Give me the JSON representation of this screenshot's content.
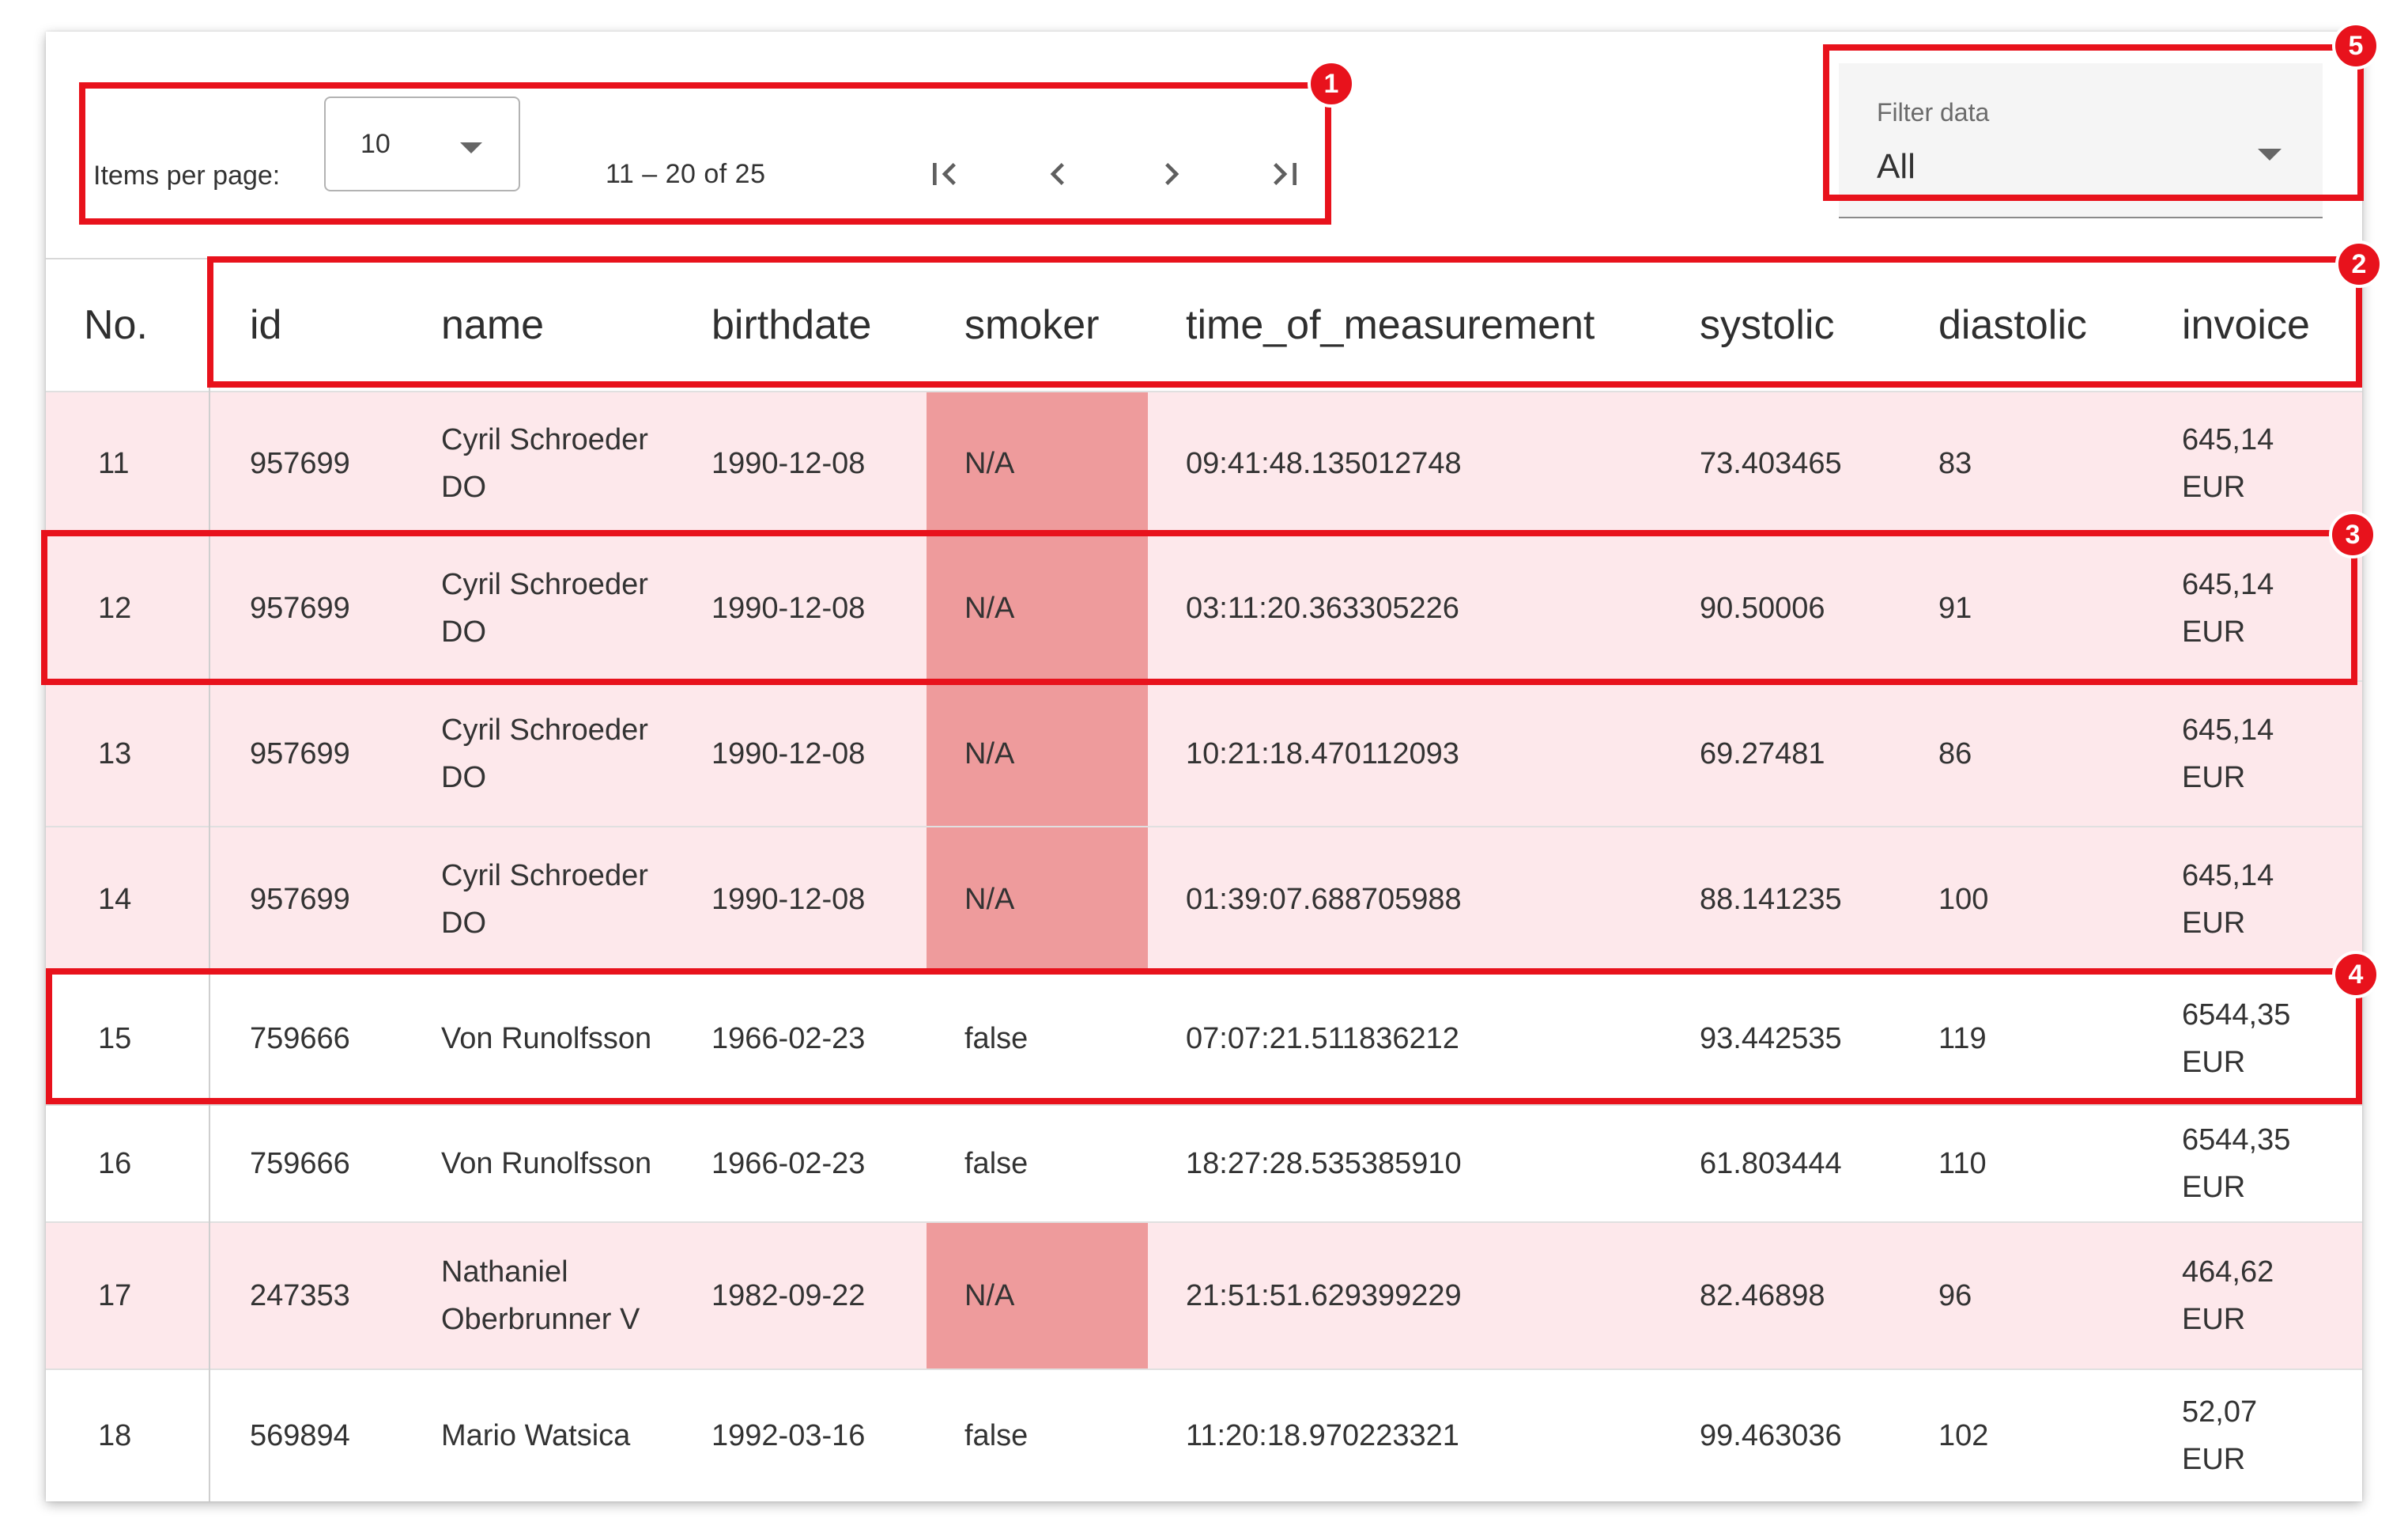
{
  "paginator": {
    "items_per_page_label": "Items per page:",
    "items_per_page_value": "10",
    "range_label": "11 – 20 of 25",
    "buttons": [
      "first-page-icon",
      "previous-page-icon",
      "next-page-icon",
      "last-page-icon"
    ]
  },
  "filter": {
    "label": "Filter data",
    "value": "All"
  },
  "table": {
    "columns": [
      "No.",
      "id",
      "name",
      "birthdate",
      "smoker",
      "time_of_measurement",
      "systolic",
      "diastolic",
      "invoice"
    ],
    "rows": [
      {
        "no": "11",
        "id": "957699",
        "name": "Cyril Schroeder DO",
        "birthdate": "1990-12-08",
        "smoker": "N/A",
        "time": "09:41:48.135012748",
        "systolic": "73.403465",
        "diastolic": "83",
        "invoice": "645,14 EUR"
      },
      {
        "no": "12",
        "id": "957699",
        "name": "Cyril Schroeder DO",
        "birthdate": "1990-12-08",
        "smoker": "N/A",
        "time": "03:11:20.363305226",
        "systolic": "90.50006",
        "diastolic": "91",
        "invoice": "645,14 EUR"
      },
      {
        "no": "13",
        "id": "957699",
        "name": "Cyril Schroeder DO",
        "birthdate": "1990-12-08",
        "smoker": "N/A",
        "time": "10:21:18.470112093",
        "systolic": "69.27481",
        "diastolic": "86",
        "invoice": "645,14 EUR"
      },
      {
        "no": "14",
        "id": "957699",
        "name": "Cyril Schroeder DO",
        "birthdate": "1990-12-08",
        "smoker": "N/A",
        "time": "01:39:07.688705988",
        "systolic": "88.141235",
        "diastolic": "100",
        "invoice": "645,14 EUR"
      },
      {
        "no": "15",
        "id": "759666",
        "name": "Von Runolfsson",
        "birthdate": "1966-02-23",
        "smoker": "false",
        "time": "07:07:21.511836212",
        "systolic": "93.442535",
        "diastolic": "119",
        "invoice": "6544,35 EUR"
      },
      {
        "no": "16",
        "id": "759666",
        "name": "Von Runolfsson",
        "birthdate": "1966-02-23",
        "smoker": "false",
        "time": "18:27:28.535385910",
        "systolic": "61.803444",
        "diastolic": "110",
        "invoice": "6544,35 EUR"
      },
      {
        "no": "17",
        "id": "247353",
        "name": "Nathaniel Oberbrunner V",
        "birthdate": "1982-09-22",
        "smoker": "N/A",
        "time": "21:51:51.629399229",
        "systolic": "82.46898",
        "diastolic": "96",
        "invoice": "464,62 EUR"
      },
      {
        "no": "18",
        "id": "569894",
        "name": "Mario Watsica",
        "birthdate": "1992-03-16",
        "smoker": "false",
        "time": "11:20:18.970223321",
        "systolic": "99.463036",
        "diastolic": "102",
        "invoice": "52,07 EUR"
      }
    ]
  },
  "annotations": [
    "1",
    "2",
    "3",
    "4",
    "5"
  ],
  "colors": {
    "row_highlight": "#fde8eb",
    "smoker_na_highlight": "#ee9b9c",
    "annotation_red": "#e8121c"
  }
}
